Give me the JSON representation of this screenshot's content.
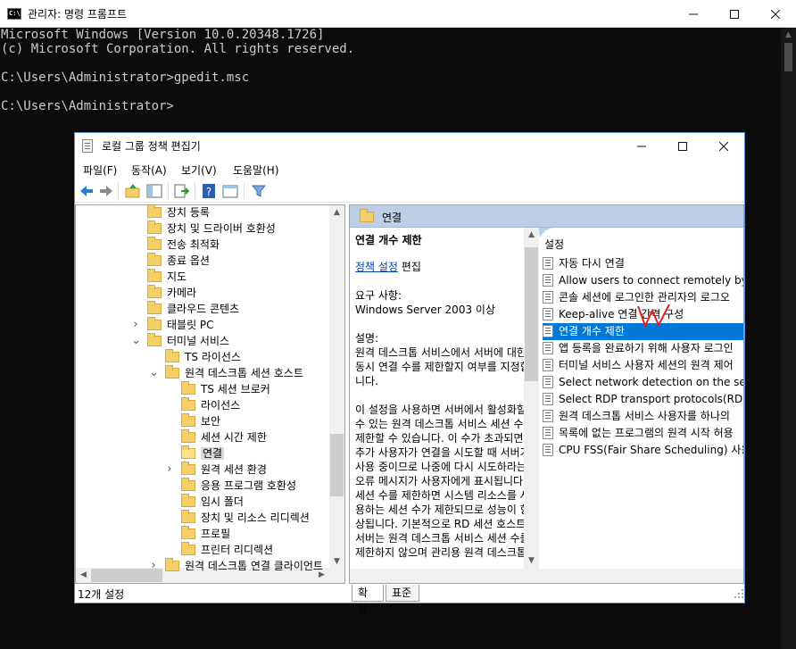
{
  "console": {
    "title": "관리자: 명령 프롬프트",
    "icon_text": "C:\\",
    "lines": [
      "Microsoft Windows [Version 10.0.20348.1726]",
      "(c) Microsoft Corporation. All rights reserved.",
      "",
      "C:\\Users\\Administrator>gpedit.msc",
      "",
      "C:\\Users\\Administrator>"
    ]
  },
  "gpedit": {
    "title": "로컬 그룹 정책 편집기",
    "menu": [
      "파일(F)",
      "동작(A)",
      "보기(V)",
      "도움말(H)"
    ],
    "tree": [
      {
        "label": "장치 등록",
        "level": 0,
        "expander": ""
      },
      {
        "label": "장치 및 드라이버 호환성",
        "level": 0,
        "expander": ""
      },
      {
        "label": "전송 최적화",
        "level": 0,
        "expander": ""
      },
      {
        "label": "종료 옵션",
        "level": 0,
        "expander": ""
      },
      {
        "label": "지도",
        "level": 0,
        "expander": ""
      },
      {
        "label": "카메라",
        "level": 0,
        "expander": ""
      },
      {
        "label": "클라우드 콘텐츠",
        "level": 0,
        "expander": ""
      },
      {
        "label": "태블릿 PC",
        "level": 0,
        "expander": ">"
      },
      {
        "label": "터미널 서비스",
        "level": 0,
        "expander": "v"
      },
      {
        "label": "TS 라이선스",
        "level": 1,
        "expander": ""
      },
      {
        "label": "원격 데스크톱 세션 호스트",
        "level": 1,
        "expander": "v"
      },
      {
        "label": "TS 세션 브로커",
        "level": 2,
        "expander": ""
      },
      {
        "label": "라이선스",
        "level": 2,
        "expander": ""
      },
      {
        "label": "보안",
        "level": 2,
        "expander": ""
      },
      {
        "label": "세션 시간 제한",
        "level": 2,
        "expander": ""
      },
      {
        "label": "연결",
        "level": 2,
        "expander": "",
        "selected": true
      },
      {
        "label": "원격 세션 환경",
        "level": 2,
        "expander": ">"
      },
      {
        "label": "응용 프로그램 호환성",
        "level": 2,
        "expander": ""
      },
      {
        "label": "임시 폴더",
        "level": 2,
        "expander": ""
      },
      {
        "label": "장치 및 리소스 리디렉션",
        "level": 2,
        "expander": ""
      },
      {
        "label": "프로필",
        "level": 2,
        "expander": ""
      },
      {
        "label": "프린터 리디렉션",
        "level": 2,
        "expander": ""
      },
      {
        "label": "원격 데스크톱 연결 클라이언트",
        "level": 1,
        "expander": ">"
      }
    ],
    "right_header": "연결",
    "desc": {
      "heading": "연결 개수 제한",
      "edit_link": "정책 설정",
      "edit_suffix": " 편집",
      "req_label": "요구 사항:",
      "req_value": "Windows Server 2003 이상",
      "desc_label": "설명:",
      "para1": "원격 데스크톱 서비스에서 서버에 대한 동시 연결 수를 제한할지 여부를 지정합니다.",
      "para2": "이 설정을 사용하면 서버에서 활성화할 수 있는 원격 데스크톱 서비스 세션 수를 제한할 수 있습니다. 이 수가 초과되면 추가 사용자가 연결을 시도할 때 서버가 사용 중이므로 나중에 다시 시도하라는 오류 메시지가 사용자에게 표시됩니다. 세션 수를 제한하면 시스템 리소스를 사용하는 세션 수가 제한되므로 성능이 향상됩니다. 기본적으로 RD 세션 호스트 서버는 원격 데스크톱 서비스 세션 수를 제한하지 않으며 관리용 원격 데스크톱"
    },
    "list_header": "설정",
    "settings": [
      "자동 다시 연결",
      "Allow users to connect remotely by us",
      "콘솔 세션에 로그인한 관리자의 로그오",
      "Keep-alive 연결 간격 구성",
      "연결 개수 제한",
      "앱 등록을 완료하기 위해 사용자 로그인",
      "터미널 서비스 사용자 세션의 원격 제어",
      "Select network detection on the server",
      "Select RDP transport protocols(RDP 전",
      "원격 데스크톱 서비스 사용자를 하나의",
      "목록에 없는 프로그램의 원격 시작 허용",
      "CPU FSS(Fair Share Scheduling) 사용"
    ],
    "selected_setting": 4,
    "tabs": [
      "확장",
      "표준"
    ],
    "status": "12개 설정",
    "colors": {
      "selection": "#0078d7",
      "header": "#bccfe7",
      "link": "#0645ad",
      "annotation": "#e0201a"
    }
  }
}
